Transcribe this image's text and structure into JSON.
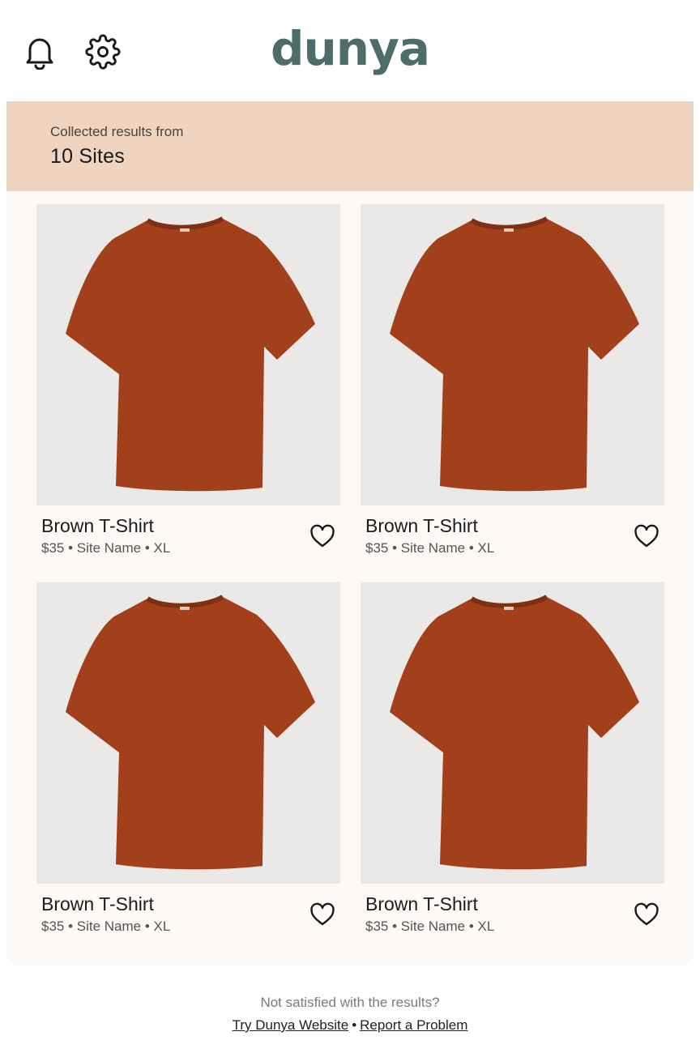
{
  "header": {
    "logo": "dunya",
    "notifications_icon": "bell-icon",
    "settings_icon": "gear-icon",
    "brand_color": "#4e6d6a"
  },
  "banner": {
    "subtitle": "Collected results from",
    "count": "10 Sites",
    "background_color": "#efd5bf"
  },
  "products": [
    {
      "name": "Brown T-Shirt",
      "price": "$35",
      "site": "Site Name",
      "size": "XL",
      "meta": "$35 • Site Name • XL",
      "image": "brown-tshirt",
      "favorite_icon": "heart-icon"
    },
    {
      "name": "Brown T-Shirt",
      "price": "$35",
      "site": "Site Name",
      "size": "XL",
      "meta": "$35 • Site Name • XL",
      "image": "brown-tshirt",
      "favorite_icon": "heart-icon"
    },
    {
      "name": "Brown T-Shirt",
      "price": "$35",
      "site": "Site Name",
      "size": "XL",
      "meta": "$35 • Site Name • XL",
      "image": "brown-tshirt",
      "favorite_icon": "heart-icon"
    },
    {
      "name": "Brown T-Shirt",
      "price": "$35",
      "site": "Site Name",
      "size": "XL",
      "meta": "$35 • Site Name • XL",
      "image": "brown-tshirt",
      "favorite_icon": "heart-icon"
    }
  ],
  "footer": {
    "question": "Not satisfied with the results?",
    "try_link": "Try Dunya Website",
    "separator": "•",
    "report_link": "Report a Problem"
  }
}
